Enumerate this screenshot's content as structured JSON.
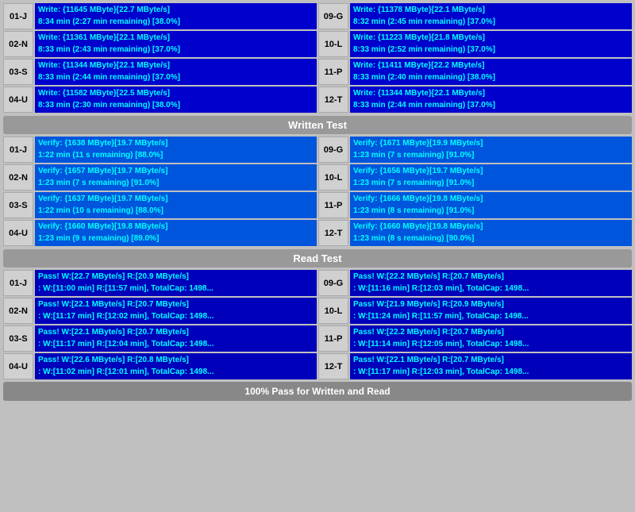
{
  "sections": {
    "write": {
      "rows": [
        {
          "left": {
            "label": "01-J",
            "line1": "Write: {11645 MByte}[22.7 MByte/s]",
            "line2": "8:34 min (2:27 min remaining)  [38.0%]"
          },
          "right": {
            "label": "09-G",
            "line1": "Write: {11378 MByte}[22.1 MByte/s]",
            "line2": "8:32 min (2:45 min remaining)  [37.0%]"
          }
        },
        {
          "left": {
            "label": "02-N",
            "line1": "Write: {11361 MByte}[22.1 MByte/s]",
            "line2": "8:33 min (2:43 min remaining)  [37.0%]"
          },
          "right": {
            "label": "10-L",
            "line1": "Write: {11223 MByte}[21.8 MByte/s]",
            "line2": "8:33 min (2:52 min remaining)  [37.0%]"
          }
        },
        {
          "left": {
            "label": "03-S",
            "line1": "Write: {11344 MByte}[22.1 MByte/s]",
            "line2": "8:33 min (2:44 min remaining)  [37.0%]"
          },
          "right": {
            "label": "11-P",
            "line1": "Write: {11411 MByte}[22.2 MByte/s]",
            "line2": "8:33 min (2:40 min remaining)  [38.0%]"
          }
        },
        {
          "left": {
            "label": "04-U",
            "line1": "Write: {11582 MByte}[22.5 MByte/s]",
            "line2": "8:33 min (2:30 min remaining)  [38.0%]"
          },
          "right": {
            "label": "12-T",
            "line1": "Write: {11344 MByte}[22.1 MByte/s]",
            "line2": "8:33 min (2:44 min remaining)  [37.0%]"
          }
        }
      ],
      "header": "Written Test"
    },
    "verify": {
      "rows": [
        {
          "left": {
            "label": "01-J",
            "line1": "Verify: {1638 MByte}[19.7 MByte/s]",
            "line2": "1:22 min (11 s remaining)   [88.0%]"
          },
          "right": {
            "label": "09-G",
            "line1": "Verify: {1671 MByte}[19.9 MByte/s]",
            "line2": "1:23 min (7 s remaining)   [91.0%]"
          }
        },
        {
          "left": {
            "label": "02-N",
            "line1": "Verify: {1657 MByte}[19.7 MByte/s]",
            "line2": "1:23 min (7 s remaining)   [91.0%]"
          },
          "right": {
            "label": "10-L",
            "line1": "Verify: {1656 MByte}[19.7 MByte/s]",
            "line2": "1:23 min (7 s remaining)   [91.0%]"
          }
        },
        {
          "left": {
            "label": "03-S",
            "line1": "Verify: {1637 MByte}[19.7 MByte/s]",
            "line2": "1:22 min (10 s remaining)   [88.0%]"
          },
          "right": {
            "label": "11-P",
            "line1": "Verify: {1666 MByte}[19.8 MByte/s]",
            "line2": "1:23 min (8 s remaining)   [91.0%]"
          }
        },
        {
          "left": {
            "label": "04-U",
            "line1": "Verify: {1660 MByte}[19.8 MByte/s]",
            "line2": "1:23 min (9 s remaining)   [89.0%]"
          },
          "right": {
            "label": "12-T",
            "line1": "Verify: {1660 MByte}[19.8 MByte/s]",
            "line2": "1:23 min (8 s remaining)   [90.0%]"
          }
        }
      ],
      "header": "Read Test"
    },
    "pass": {
      "rows": [
        {
          "left": {
            "label": "01-J",
            "line1": "Pass! W:[22.7 MByte/s] R:[20.9 MByte/s]",
            "line2": ": W:[11:00 min] R:[11:57 min], TotalCap: 1498..."
          },
          "right": {
            "label": "09-G",
            "line1": "Pass! W:[22.2 MByte/s] R:[20.7 MByte/s]",
            "line2": ": W:[11:16 min] R:[12:03 min], TotalCap: 1498..."
          }
        },
        {
          "left": {
            "label": "02-N",
            "line1": "Pass! W:[22.1 MByte/s] R:[20.7 MByte/s]",
            "line2": ": W:[11:17 min] R:[12:02 min], TotalCap: 1498..."
          },
          "right": {
            "label": "10-L",
            "line1": "Pass! W:[21.9 MByte/s] R:[20.9 MByte/s]",
            "line2": ": W:[11:24 min] R:[11:57 min], TotalCap: 1498..."
          }
        },
        {
          "left": {
            "label": "03-S",
            "line1": "Pass! W:[22.1 MByte/s] R:[20.7 MByte/s]",
            "line2": ": W:[11:17 min] R:[12:04 min], TotalCap: 1498..."
          },
          "right": {
            "label": "11-P",
            "line1": "Pass! W:[22.2 MByte/s] R:[20.7 MByte/s]",
            "line2": ": W:[11:14 min] R:[12:05 min], TotalCap: 1498..."
          }
        },
        {
          "left": {
            "label": "04-U",
            "line1": "Pass! W:[22.6 MByte/s] R:[20.8 MByte/s]",
            "line2": ": W:[11:02 min] R:[12:01 min], TotalCap: 1498..."
          },
          "right": {
            "label": "12-T",
            "line1": "Pass! W:[22.1 MByte/s] R:[20.7 MByte/s]",
            "line2": ": W:[11:17 min] R:[12:03 min], TotalCap: 1498..."
          }
        }
      ],
      "header": "Read Test"
    }
  },
  "bottom_bar": "100% Pass for Written and Read",
  "written_header": "Written Test",
  "read_header": "Read Test"
}
